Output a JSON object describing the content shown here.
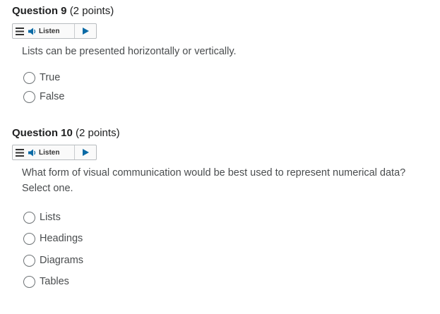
{
  "questions": [
    {
      "title": "Question 9",
      "points": "(2 points)",
      "listen_label": "Listen",
      "text_lines": [
        "Lists can be presented horizontally or vertically."
      ],
      "options": [
        "True",
        "False"
      ]
    },
    {
      "title": "Question 10",
      "points": "(2 points)",
      "listen_label": "Listen",
      "text_lines": [
        "What form of visual communication would be best used to represent numerical data?",
        "Select one."
      ],
      "options": [
        "Lists",
        "Headings",
        "Diagrams",
        "Tables"
      ]
    }
  ],
  "icons": {
    "menu": "menu-icon",
    "speaker": "speaker-icon",
    "play": "play-icon"
  },
  "colors": {
    "title": "#202122",
    "body_text": "#494c4e",
    "icon_blue": "#0a6aa5"
  }
}
